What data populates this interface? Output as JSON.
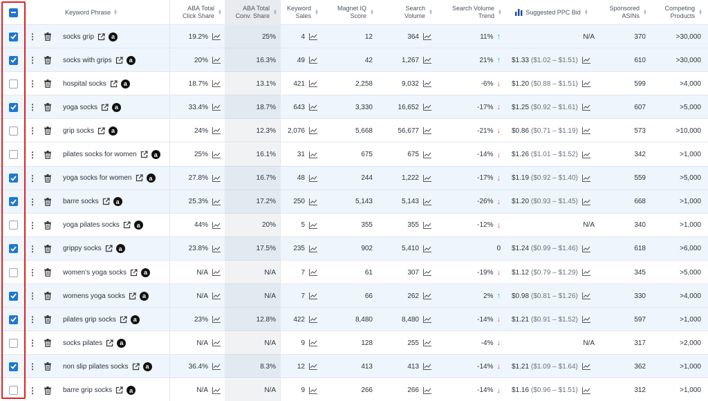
{
  "header": {
    "keyword": "Keyword Phrase",
    "aba_click": [
      "ABA Total",
      "Click Share"
    ],
    "aba_conv": [
      "ABA Total",
      "Conv. Share"
    ],
    "kw_sales": [
      "Keyword",
      "Sales"
    ],
    "miq": [
      "Magnet IQ",
      "Score"
    ],
    "sv": [
      "Search",
      "Volume"
    ],
    "svt": [
      "Search Volume",
      "Trend"
    ],
    "ppc": "Suggested PPC Bid",
    "spon": [
      "Sponsored",
      "ASINs"
    ],
    "comp": [
      "Competing",
      "Products"
    ]
  },
  "colors": {
    "accent": "#1f77d0",
    "up": "#2bb673",
    "down": "#e5484d",
    "highlight": "#e02020"
  },
  "icons": {
    "menu": "kebab-icon",
    "delete": "trash-icon",
    "open": "external-link-icon",
    "amazon": "amazon-icon",
    "chart": "sparkline-icon"
  },
  "rows": [
    {
      "checked": true,
      "kw": "socks grip",
      "click": "19.2%",
      "conv": "25%",
      "sales": "4",
      "miq": "12",
      "sv": "364",
      "trend": "11%",
      "dir": "up",
      "bid": "",
      "range": "",
      "bid_na": "N/A",
      "spon": "370",
      "comp": ">30,000"
    },
    {
      "checked": true,
      "kw": "socks with grips",
      "click": "20%",
      "conv": "16.3%",
      "sales": "49",
      "miq": "42",
      "sv": "1,267",
      "trend": "21%",
      "dir": "up",
      "bid": "$1.33",
      "range": "($1.02 – $1.51)",
      "bid_na": "",
      "spon": "610",
      "comp": ">30,000"
    },
    {
      "checked": false,
      "kw": "hospital socks",
      "click": "18.7%",
      "conv": "13.1%",
      "sales": "421",
      "miq": "2,258",
      "sv": "9,032",
      "trend": "-6%",
      "dir": "down",
      "bid": "$1.20",
      "range": "($0.88 – $1.51)",
      "bid_na": "",
      "spon": "599",
      "comp": ">4,000"
    },
    {
      "checked": true,
      "kw": "yoga socks",
      "click": "33.4%",
      "conv": "18.7%",
      "sales": "643",
      "miq": "3,330",
      "sv": "16,652",
      "trend": "-17%",
      "dir": "down",
      "bid": "$1.25",
      "range": "($0.92 – $1.61)",
      "bid_na": "",
      "spon": "607",
      "comp": ">5,000"
    },
    {
      "checked": false,
      "kw": "grip socks",
      "click": "24%",
      "conv": "12.3%",
      "sales": "2,076",
      "miq": "5,668",
      "sv": "56,677",
      "trend": "-21%",
      "dir": "down",
      "bid": "$0.86",
      "range": "($0.71 – $1.19)",
      "bid_na": "",
      "spon": "573",
      "comp": ">10,000"
    },
    {
      "checked": false,
      "kw": "pilates socks for women",
      "click": "25%",
      "conv": "16.1%",
      "sales": "31",
      "miq": "675",
      "sv": "675",
      "trend": "-14%",
      "dir": "down",
      "bid": "$1.26",
      "range": "($1.01 – $1.52)",
      "bid_na": "",
      "spon": "342",
      "comp": ">1,000"
    },
    {
      "checked": true,
      "kw": "yoga socks for women",
      "click": "27.8%",
      "conv": "16.7%",
      "sales": "48",
      "miq": "244",
      "sv": "1,222",
      "trend": "-17%",
      "dir": "down",
      "bid": "$1.19",
      "range": "($0.92 – $1.40)",
      "bid_na": "",
      "spon": "559",
      "comp": ">5,000"
    },
    {
      "checked": true,
      "kw": "barre socks",
      "click": "25.3%",
      "conv": "17.2%",
      "sales": "250",
      "miq": "5,143",
      "sv": "5,143",
      "trend": "-26%",
      "dir": "down",
      "bid": "$1.20",
      "range": "($0.93 – $1.45)",
      "bid_na": "",
      "spon": "668",
      "comp": ">1,000"
    },
    {
      "checked": false,
      "kw": "yoga pilates socks",
      "click": "44%",
      "conv": "20%",
      "sales": "5",
      "miq": "355",
      "sv": "355",
      "trend": "-12%",
      "dir": "down",
      "bid": "",
      "range": "",
      "bid_na": "N/A",
      "spon": "340",
      "comp": ">1,000"
    },
    {
      "checked": true,
      "kw": "grippy socks",
      "click": "23.8%",
      "conv": "17.5%",
      "sales": "235",
      "miq": "902",
      "sv": "5,410",
      "trend": "0",
      "dir": "none",
      "bid": "$1.24",
      "range": "($0.99 – $1.46)",
      "bid_na": "",
      "spon": "618",
      "comp": ">6,000"
    },
    {
      "checked": false,
      "kw": "women's yoga socks",
      "click": "N/A",
      "conv": "N/A",
      "sales": "7",
      "miq": "61",
      "sv": "307",
      "trend": "-19%",
      "dir": "down",
      "bid": "$1.12",
      "range": "($0.79 – $1.29)",
      "bid_na": "",
      "spon": "345",
      "comp": ">5,000"
    },
    {
      "checked": true,
      "kw": "womens yoga socks",
      "click": "N/A",
      "conv": "N/A",
      "sales": "7",
      "miq": "66",
      "sv": "262",
      "trend": "2%",
      "dir": "up",
      "bid": "$0.98",
      "range": "($0.81 – $1.26)",
      "bid_na": "",
      "spon": "330",
      "comp": ">4,000"
    },
    {
      "checked": true,
      "kw": "pilates grip socks",
      "click": "23%",
      "conv": "12.8%",
      "sales": "422",
      "miq": "8,480",
      "sv": "8,480",
      "trend": "-14%",
      "dir": "down",
      "bid": "$1.21",
      "range": "($0.91 – $1.52)",
      "bid_na": "",
      "spon": "597",
      "comp": ">1,000"
    },
    {
      "checked": false,
      "kw": "socks pilates",
      "click": "N/A",
      "conv": "N/A",
      "sales": "9",
      "miq": "128",
      "sv": "255",
      "trend": "-4%",
      "dir": "down",
      "bid": "",
      "range": "",
      "bid_na": "N/A",
      "spon": "317",
      "comp": ">2,000"
    },
    {
      "checked": true,
      "kw": "non slip pilates socks",
      "click": "36.4%",
      "conv": "8.3%",
      "sales": "12",
      "miq": "413",
      "sv": "413",
      "trend": "-14%",
      "dir": "down",
      "bid": "$1.21",
      "range": "($1.09 – $1.64)",
      "bid_na": "",
      "spon": "362",
      "comp": ">1,000"
    },
    {
      "checked": false,
      "kw": "barre grip socks",
      "click": "N/A",
      "conv": "N/A",
      "sales": "9",
      "miq": "266",
      "sv": "266",
      "trend": "-14%",
      "dir": "down",
      "bid": "$1.16",
      "range": "($0.96 – $1.51)",
      "bid_na": "",
      "spon": "312",
      "comp": ">1,000"
    }
  ]
}
